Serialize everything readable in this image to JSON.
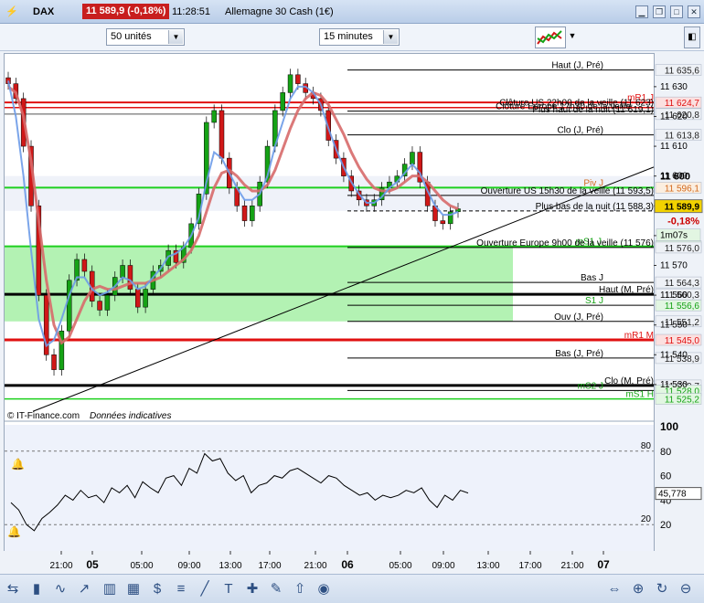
{
  "title_bar": {
    "symbol": "DAX",
    "price_badge": "11 589,9 (-0,18%)",
    "time": "11:28:51",
    "instrument": "Allemagne 30 Cash (1€)"
  },
  "toolbar": {
    "units": "50 unités",
    "timeframe": "15 minutes"
  },
  "footer": {
    "credit": "© IT-Finance.com",
    "note": "Données indicatives"
  },
  "colors": {
    "candle_up": "#15a215",
    "candle_down": "#d01818",
    "ma_fast": "#6d9be8",
    "ma_slow": "#d76a6a",
    "support_zone": "#a6f0a6",
    "resistance_line": "#e01010",
    "support_line": "#1ed01e"
  },
  "chart_data": [
    {
      "type": "candlestick",
      "instrument": "Allemagne 30 Cash (1€)",
      "timeframe": "15 minutes",
      "x_ticks": [
        "21:00",
        "05",
        "05:00",
        "09:00",
        "13:00",
        "17:00",
        "21:00",
        "06",
        "05:00",
        "09:00",
        "13:00",
        "17:00",
        "21:00",
        "07"
      ],
      "x_ticks_bold": [
        "05",
        "06",
        "07"
      ],
      "y_ticks": [
        "11 630",
        "11 620",
        "11 610",
        "11 600",
        "11 590",
        "11 580",
        "11 570",
        "11 560",
        "11 550",
        "11 540",
        "11 530"
      ],
      "ylim": [
        11522,
        11641
      ],
      "last_price": "11 589,9",
      "last_change": "-0,18%",
      "countdown": "1m07s",
      "candles_close": [
        11631,
        11626,
        11610,
        11590,
        11560,
        11540,
        11535,
        11548,
        11565,
        11572,
        11568,
        11558,
        11555,
        11560,
        11566,
        11570,
        11562,
        11556,
        11562,
        11568,
        11570,
        11575,
        11571,
        11576,
        11584,
        11594,
        11618,
        11622,
        11606,
        11596,
        11590,
        11585,
        11590,
        11598,
        11610,
        11622,
        11628,
        11634,
        11631,
        11628,
        11626,
        11622,
        11612,
        11606,
        11600,
        11595,
        11592,
        11590,
        11592,
        11596,
        11598,
        11600,
        11604,
        11608,
        11598,
        11590,
        11585,
        11584,
        11588,
        11589
      ],
      "moving_averages": [
        {
          "values": [
            11632,
            11620,
            11600,
            11575,
            11552,
            11543,
            11545,
            11552,
            11560,
            11566,
            11566,
            11562,
            11560,
            11561,
            11563,
            11566,
            11565,
            11562,
            11563,
            11566,
            11569,
            11573,
            11574,
            11576,
            11580,
            11586,
            11598,
            11608,
            11606,
            11601,
            11596,
            11592,
            11592,
            11594,
            11600,
            11610,
            11618,
            11626,
            11630,
            11630,
            11628,
            11624,
            11616,
            11609,
            11603,
            11598,
            11594,
            11591,
            11591,
            11593,
            11596,
            11598,
            11601,
            11604,
            11601,
            11595,
            11590,
            11587,
            11587,
            11588
          ]
        },
        {
          "values": [
            11630,
            11628,
            11620,
            11605,
            11585,
            11565,
            11550,
            11544,
            11546,
            11552,
            11558,
            11562,
            11563,
            11562,
            11562,
            11563,
            11564,
            11564,
            11564,
            11565,
            11566,
            11568,
            11570,
            11572,
            11575,
            11580,
            11588,
            11596,
            11601,
            11602,
            11600,
            11597,
            11595,
            11595,
            11597,
            11602,
            11609,
            11616,
            11622,
            11626,
            11628,
            11627,
            11624,
            11619,
            11614,
            11608,
            11603,
            11599,
            11596,
            11595,
            11595,
            11596,
            11598,
            11600,
            11600,
            11598,
            11595,
            11592,
            11590,
            11589
          ]
        }
      ],
      "levels": [
        {
          "label": "Haut (J, Pré)",
          "value": "11 635,6",
          "color": "#000000"
        },
        {
          "label": "mR1 J",
          "value": "11 624,7",
          "color": "#e01010"
        },
        {
          "label": "Clôture US 22h00 de la veille (11 623)",
          "value": "",
          "color": "#000000"
        },
        {
          "label": "Clôture Europe 17h30 de la veille",
          "value": "",
          "color": "#000000"
        },
        {
          "label": "Plus haut de la nuit (11 619,1)",
          "value": "11 620,8",
          "color": "#000000"
        },
        {
          "label": "Clo (J, Pré)",
          "value": "11 613,8",
          "color": "#000000"
        },
        {
          "label": "Piv J",
          "value": "11 596,1",
          "color": "#d2691e"
        },
        {
          "label": "Ouverture US 15h30 de la veille (11 593,5)",
          "value": "",
          "color": "#000000"
        },
        {
          "label": "Plus bas de la nuit (11 588,3)",
          "value": "",
          "color": "#000000"
        },
        {
          "label": "mS1 J",
          "value": "11 576,4",
          "color": "#15a215"
        },
        {
          "label": "Ouverture Europe 9h00 de la veille (11 576)",
          "value": "11 576,0",
          "color": "#000000"
        },
        {
          "label": "Bas J",
          "value": "11 564,3",
          "color": "#000000"
        },
        {
          "label": "Haut (M, Pré)",
          "value": "11 560,3",
          "color": "#000000"
        },
        {
          "label": "S1 J",
          "value": "11 556,6",
          "color": "#15a215"
        },
        {
          "label": "Ouv (J, Pré)",
          "value": "11 551,2",
          "color": "#000000"
        },
        {
          "label": "mR1 M",
          "value": "11 545,0",
          "color": "#e01010"
        },
        {
          "label": "Bas (J, Pré)",
          "value": "11 538,9",
          "color": "#000000"
        },
        {
          "label": "Clo (M, Pré)",
          "value": "11 529,7",
          "color": "#000000"
        },
        {
          "label": "mS2 J",
          "value": "11 528,0",
          "color": "#15a215"
        },
        {
          "label": "mS1 H",
          "value": "11 525,2",
          "color": "#15a215"
        }
      ]
    },
    {
      "type": "line",
      "y_ticks": [
        "100",
        "80",
        "60",
        "40",
        "20"
      ],
      "ylim": [
        0,
        100
      ],
      "levels": [
        "80",
        "20"
      ],
      "last_value": "45,778",
      "values": [
        38,
        32,
        20,
        15,
        25,
        30,
        36,
        44,
        40,
        48,
        42,
        44,
        38,
        50,
        46,
        52,
        42,
        55,
        50,
        46,
        58,
        60,
        52,
        66,
        62,
        78,
        72,
        74,
        62,
        56,
        60,
        46,
        52,
        54,
        60,
        58,
        64,
        66,
        62,
        58,
        54,
        60,
        58,
        52,
        48,
        44,
        46,
        40,
        44,
        42,
        44,
        48,
        46,
        50,
        40,
        34,
        44,
        40,
        48,
        45.8
      ]
    }
  ]
}
